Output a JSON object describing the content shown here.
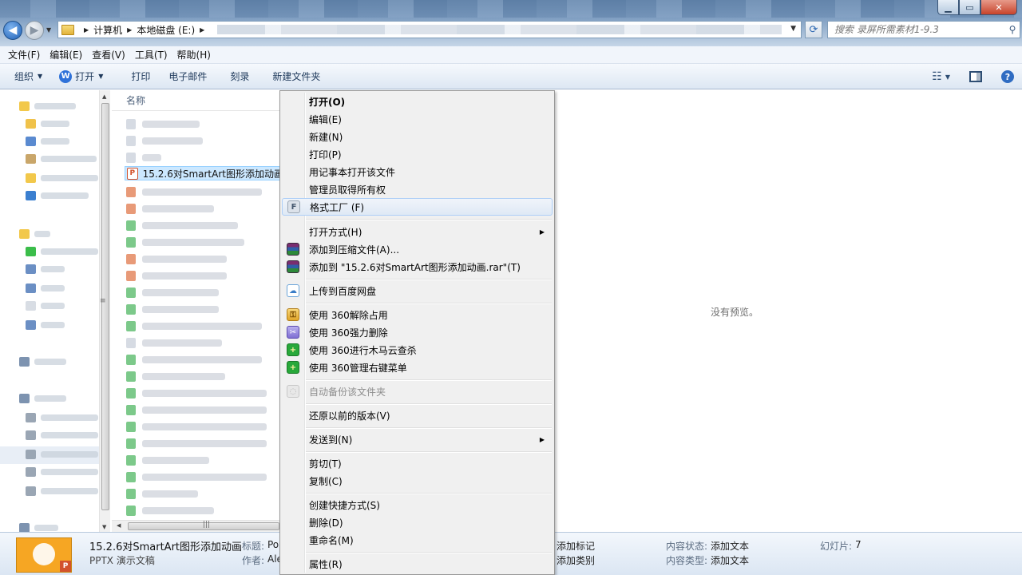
{
  "window": {
    "controls": {
      "minimize": "▁",
      "maximize": "▭",
      "close": "✕"
    }
  },
  "navigation": {
    "back": "◀",
    "forward": "▶",
    "history_drop": "▼"
  },
  "address": {
    "crumbs": [
      "计算机",
      "本地磁盘 (E:)"
    ],
    "separator": "▶",
    "dropdown": "▼",
    "refresh": "⟳"
  },
  "search": {
    "placeholder": "搜索 录屏所需素材1-9.3",
    "icon": "search-icon"
  },
  "menubar": [
    "文件(F)",
    "编辑(E)",
    "查看(V)",
    "工具(T)",
    "帮助(H)"
  ],
  "commandbar": {
    "organize": "组织",
    "open": "打开",
    "print": "打印",
    "email": "电子邮件",
    "burn": "刻录",
    "new_folder": "新建文件夹",
    "open_icon_letter": "W",
    "view_icon": "☷",
    "dropdown": "▼",
    "help": "?"
  },
  "filelist": {
    "column_name": "名称",
    "selected_file": "15.2.6对SmartArt图形添加动画",
    "ppt_letter": "P"
  },
  "preview": {
    "text": "没有预览。"
  },
  "context_menu": {
    "items": [
      {
        "label": "打开(O)",
        "bold": true
      },
      {
        "label": "编辑(E)"
      },
      {
        "label": "新建(N)"
      },
      {
        "label": "打印(P)"
      },
      {
        "label": "用记事本打开该文件"
      },
      {
        "label": "管理员取得所有权"
      },
      {
        "label": "格式工厂 (F)",
        "icon": "format-factory-icon"
      },
      {
        "label": "打开方式(H)",
        "submenu": "▶"
      },
      {
        "label": "添加到压缩文件(A)...",
        "icon": "winrar-icon"
      },
      {
        "label": "添加到 \"15.2.6对SmartArt图形添加动画.rar\"(T)",
        "icon": "winrar-icon"
      },
      {
        "label": "上传到百度网盘",
        "icon": "baidu-cloud-icon"
      },
      {
        "label": "使用 360解除占用",
        "icon": "unlock-icon"
      },
      {
        "label": "使用 360强力删除",
        "icon": "shred-icon"
      },
      {
        "label": "使用 360进行木马云查杀",
        "icon": "360-icon"
      },
      {
        "label": "使用 360管理右键菜单",
        "icon": "360-icon"
      },
      {
        "label": "自动备份该文件夹",
        "icon": "backup-icon",
        "disabled": true
      },
      {
        "label": "还原以前的版本(V)"
      },
      {
        "label": "发送到(N)",
        "submenu": "▶"
      },
      {
        "label": "剪切(T)"
      },
      {
        "label": "复制(C)"
      },
      {
        "label": "创建快捷方式(S)"
      },
      {
        "label": "删除(D)"
      },
      {
        "label": "重命名(M)"
      },
      {
        "label": "属性(R)"
      }
    ]
  },
  "details": {
    "file_name": "15.2.6对SmartArt图形添加动画",
    "file_type": "PPTX 演示文稿",
    "title_label": "标题:",
    "title_value": "Po",
    "author_label": "作者:",
    "author_value": "Ale",
    "tags_value": "添加标记",
    "category_value": "添加类别",
    "content_status_label": "内容状态:",
    "content_status_value": "添加文本",
    "content_type_label": "内容类型:",
    "content_type_value": "添加文本",
    "slides_label": "幻灯片:",
    "slides_value": "7"
  }
}
